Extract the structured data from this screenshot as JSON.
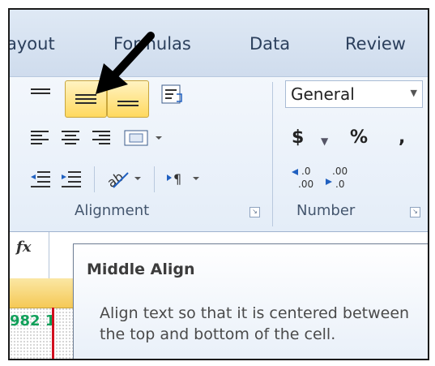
{
  "tabs": [
    "ayout",
    "Formulas",
    "Data",
    "Review"
  ],
  "groups": {
    "alignment_label": "Alignment",
    "number_label": "Number"
  },
  "number": {
    "format_value": "General",
    "currency_symbol": "$",
    "percent_symbol": "%",
    "comma_symbol": ","
  },
  "formula_bar": {
    "fx_label": "fx"
  },
  "sheet": {
    "visible_cell_text": "982 1"
  },
  "tooltip": {
    "title": "Middle Align",
    "body": "Align text so that it is centered between the top and bottom of the cell."
  },
  "colors": {
    "highlight": "#ffd95f",
    "green_text": "#11a05a",
    "red_border": "#d10f1f"
  }
}
